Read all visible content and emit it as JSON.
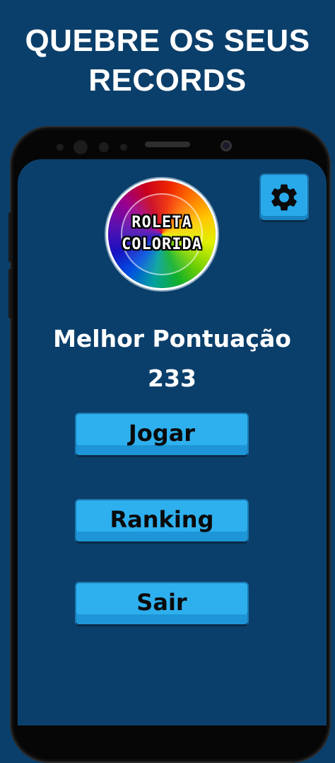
{
  "promo": {
    "line1": "QUEBRE OS SEUS",
    "line2": "RECORDS"
  },
  "logo": {
    "line1": "ROLETA",
    "line2": "COLORIDA"
  },
  "best_score": {
    "label": "Melhor Pontuação",
    "value": "233"
  },
  "menu": {
    "play_label": "Jogar",
    "ranking_label": "Ranking",
    "exit_label": "Sair"
  },
  "icons": {
    "settings": "gear-icon"
  },
  "colors": {
    "background": "#0b3f6b",
    "button": "#2fb0ee",
    "button_text": "#0a0a0a",
    "text": "#ffffff"
  }
}
